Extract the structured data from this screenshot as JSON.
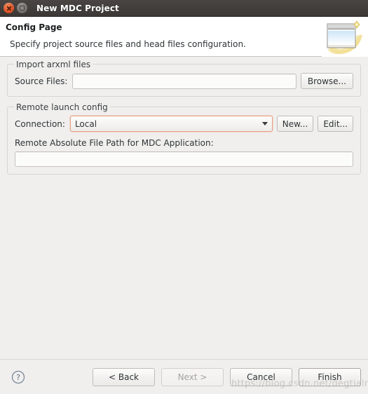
{
  "window": {
    "title": "New MDC Project",
    "close_icon": "close-icon",
    "maximize_icon": "maximize-icon"
  },
  "header": {
    "title": "Config Page",
    "description": "Specify project source files and head files configuration.",
    "banner_icon": "wizard-banner-icon"
  },
  "groups": {
    "import": {
      "title": "Import arxml files",
      "source_files_label": "Source Files:",
      "source_files_value": "",
      "source_files_placeholder": "",
      "browse_label": "Browse..."
    },
    "remote": {
      "title": "Remote launch config",
      "connection_label": "Connection:",
      "connection_value": "Local",
      "connection_options": [
        "Local"
      ],
      "new_label": "New...",
      "edit_label": "Edit...",
      "remote_path_label": "Remote Absolute File Path for MDC Application:",
      "remote_path_value": "",
      "remote_path_placeholder": ""
    }
  },
  "footer": {
    "help_icon": "help-icon",
    "back_label": "< Back",
    "next_label": "Next >",
    "cancel_label": "Cancel",
    "finish_label": "Finish",
    "watermark": "https://blog.csdn.net/degtialr"
  },
  "colors": {
    "titlebar": "#3b3836",
    "close_button": "#e2572c",
    "focus_border": "#e8a286",
    "content_background": "#f0efee",
    "header_background": "#ffffff"
  }
}
